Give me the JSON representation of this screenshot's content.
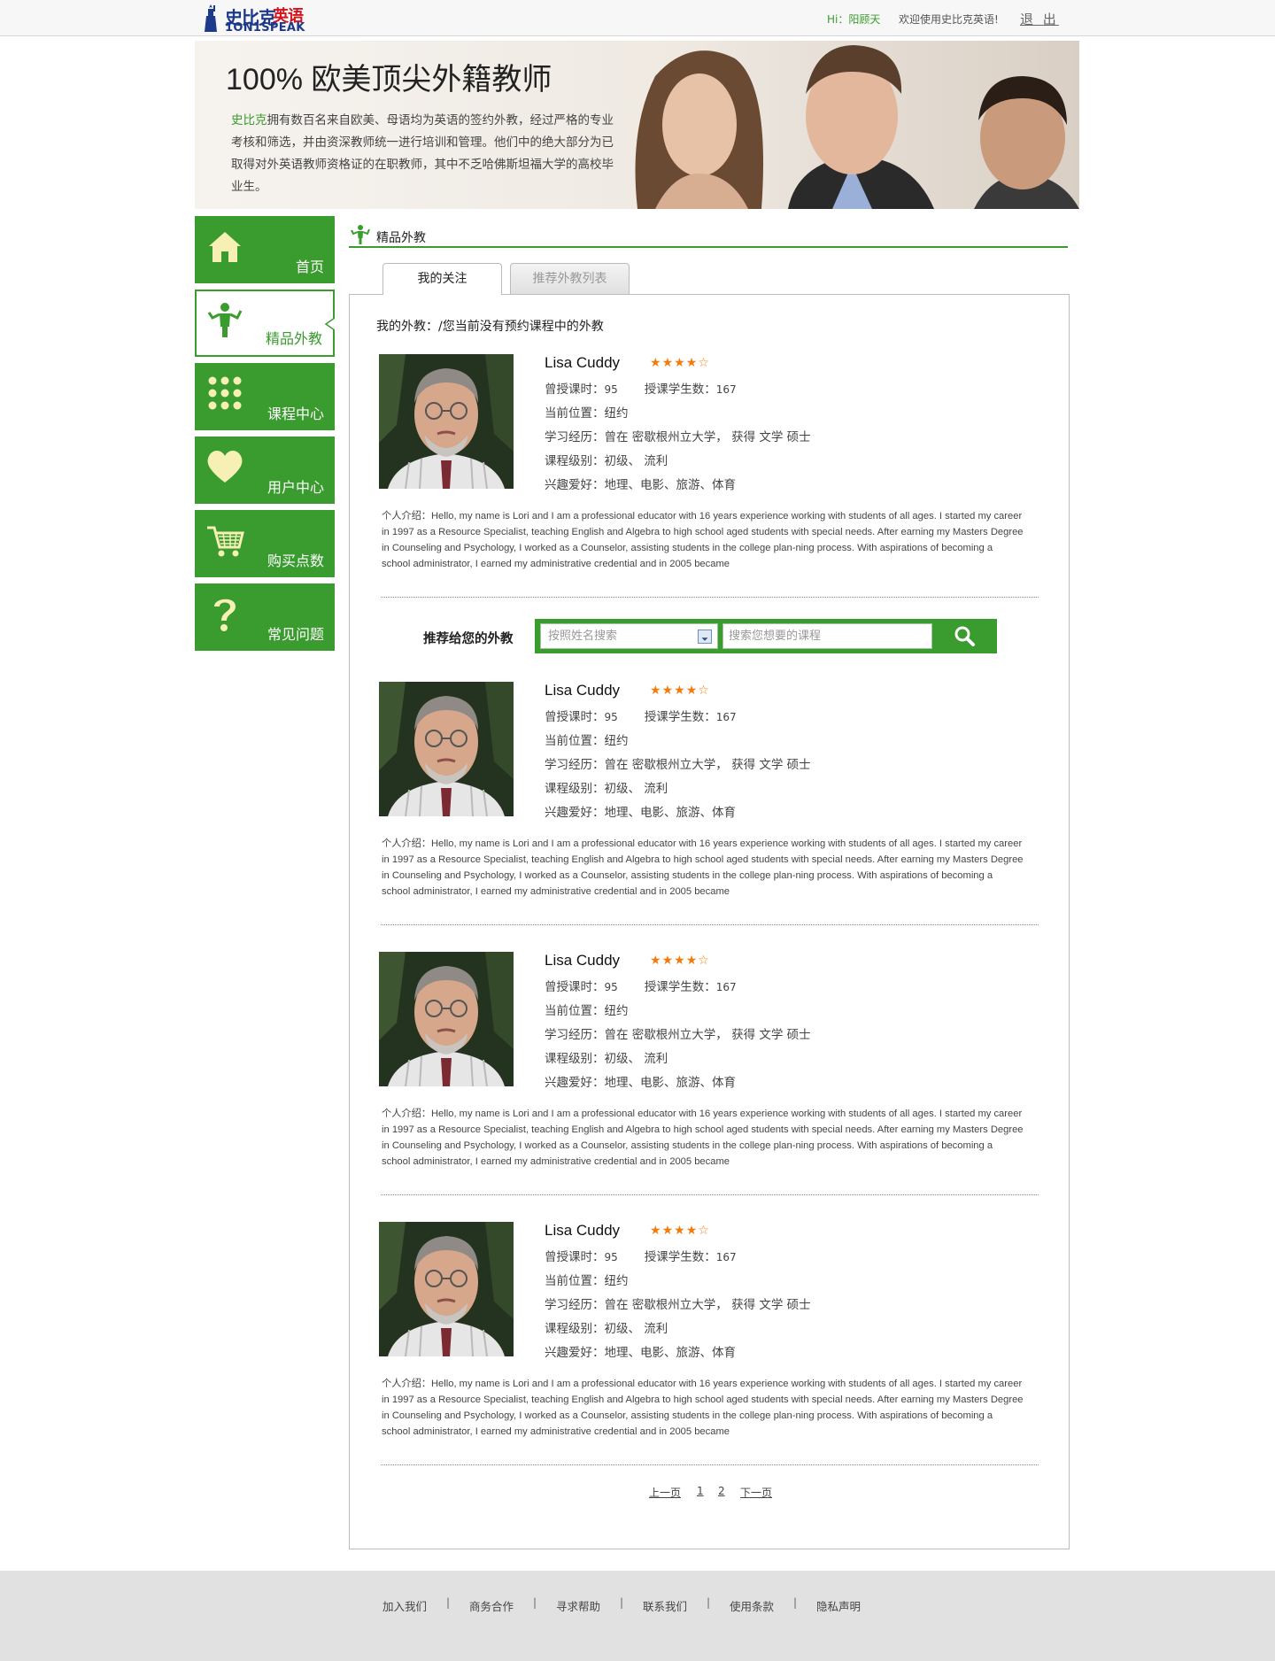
{
  "header": {
    "logo_cn_1": "史比克",
    "logo_cn_2": "英语",
    "logo_en": "1ON1SPEAK",
    "greeting": "Hi：阳顾天",
    "welcome": "欢迎使用史比克英语!",
    "logout": "退 出"
  },
  "banner": {
    "title": "100% 欧美顶尖外籍教师",
    "brand": "史比克",
    "text": "拥有数百名来自欧美、母语均为英语的签约外教，经过严格的专业考核和筛选，并由资深教师统一进行培训和管理。他们中的绝大部分为已取得对外英语教师资格证的在职教师，其中不乏哈佛斯坦福大学的高校毕业生。"
  },
  "sidebar": {
    "items": [
      {
        "label": "首页",
        "icon": "home-icon"
      },
      {
        "label": "精品外教",
        "icon": "teacher-icon"
      },
      {
        "label": "课程中心",
        "icon": "grid-dots-icon"
      },
      {
        "label": "用户中心",
        "icon": "heart-icon"
      },
      {
        "label": "购买点数",
        "icon": "cart-icon"
      },
      {
        "label": "常见问题",
        "icon": "question-icon"
      }
    ]
  },
  "main": {
    "section_title": "精品外教",
    "tabs": [
      {
        "label": "我的关注"
      },
      {
        "label": "推荐外教列表"
      }
    ],
    "my_teacher_note": "我的外教：/您当前没有预约课程中的外教",
    "recommend_label": "推荐给您的外教",
    "search": {
      "select_placeholder": "按照姓名搜索",
      "input_placeholder": "搜索您想要的课程"
    },
    "teachers": [
      {
        "name": "Lisa Cuddy",
        "rating": 4,
        "hours_label": "曾授课时：",
        "hours": "95",
        "students_label": "授课学生数：",
        "students": "167",
        "location": "当前位置：纽约",
        "education": "学习经历：曾在  密歇根州立大学，  获得  文学  硕士",
        "levels": "课程级别：初级、  流利",
        "hobbies": "兴趣爱好：地理、电影、旅游、体育",
        "intro_label": "个人介绍：",
        "intro": "Hello, my name is Lori and I am a professional educator with 16 years experience working with students of all ages. I started my career in 1997 as a Resource Specialist, teaching English and Algebra to high school aged students with special needs. After earning my Masters Degree in Counseling and Psychology, I worked as a Counselor, assisting students in the college plan-ning process. With aspirations of becoming a school administrator, I earned my administrative credential and in 2005 became"
      },
      {
        "name": "Lisa Cuddy",
        "rating": 4,
        "hours_label": "曾授课时：",
        "hours": "95",
        "students_label": "授课学生数：",
        "students": "167",
        "location": "当前位置：纽约",
        "education": "学习经历：曾在  密歇根州立大学，  获得  文学  硕士",
        "levels": "课程级别：初级、  流利",
        "hobbies": "兴趣爱好：地理、电影、旅游、体育",
        "intro_label": "个人介绍：",
        "intro": "Hello, my name is Lori and I am a professional educator with 16 years experience working with students of all ages. I started my career in 1997 as a Resource Specialist, teaching English and Algebra to high school aged students with special needs. After earning my Masters Degree in Counseling and Psychology, I worked as a Counselor, assisting students in the college plan-ning process. With aspirations of becoming a school administrator, I earned my administrative credential and in 2005 became"
      },
      {
        "name": "Lisa Cuddy",
        "rating": 4,
        "hours_label": "曾授课时：",
        "hours": "95",
        "students_label": "授课学生数：",
        "students": "167",
        "location": "当前位置：纽约",
        "education": "学习经历：曾在  密歇根州立大学，  获得  文学  硕士",
        "levels": "课程级别：初级、  流利",
        "hobbies": "兴趣爱好：地理、电影、旅游、体育",
        "intro_label": "个人介绍：",
        "intro": "Hello, my name is Lori and I am a professional educator with 16 years experience working with students of all ages. I started my career in 1997 as a Resource Specialist, teaching English and Algebra to high school aged students with special needs. After earning my Masters Degree in Counseling and Psychology, I worked as a Counselor, assisting students in the college plan-ning process. With aspirations of becoming a school administrator, I earned my administrative credential and in 2005 became"
      },
      {
        "name": "Lisa Cuddy",
        "rating": 4,
        "hours_label": "曾授课时：",
        "hours": "95",
        "students_label": "授课学生数：",
        "students": "167",
        "location": "当前位置：纽约",
        "education": "学习经历：曾在  密歇根州立大学，  获得  文学  硕士",
        "levels": "课程级别：初级、  流利",
        "hobbies": "兴趣爱好：地理、电影、旅游、体育",
        "intro_label": "个人介绍：",
        "intro": "Hello, my name is Lori and I am a professional educator with 16 years experience working with students of all ages. I started my career in 1997 as a Resource Specialist, teaching English and Algebra to high school aged students with special needs. After earning my Masters Degree in Counseling and Psychology, I worked as a Counselor, assisting students in the college plan-ning process. With aspirations of becoming a school administrator, I earned my administrative credential and in 2005 became"
      }
    ],
    "pagination": {
      "prev": "上一页",
      "pages": [
        "1",
        "2"
      ],
      "next": "下一页"
    }
  },
  "footer": {
    "links": [
      "加入我们",
      "商务合作",
      "寻求帮助",
      "联系我们",
      "使用条款",
      "隐私声明"
    ],
    "separator": "|"
  },
  "colors": {
    "brand_green": "#3a9b2e",
    "star_orange": "#f27b0c",
    "logo_blue": "#1d3a8a",
    "logo_red": "#d4141c"
  }
}
